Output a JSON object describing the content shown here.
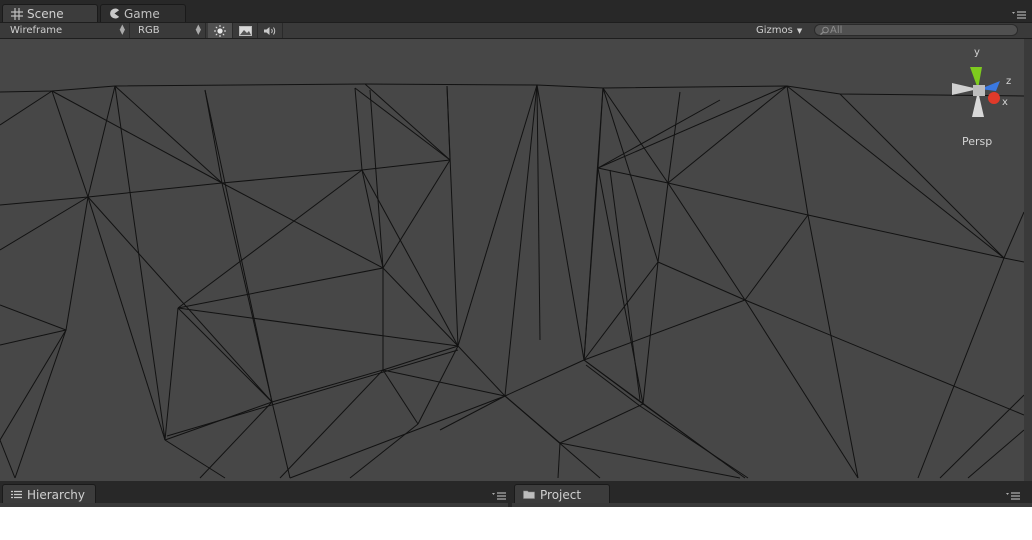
{
  "scene_view": {
    "tabs": [
      {
        "label": "Scene",
        "icon": "grid-icon",
        "active": true
      },
      {
        "label": "Game",
        "icon": "pacman-icon",
        "active": false
      }
    ],
    "toolbar": {
      "draw_mode": "Wireframe",
      "render_mode": "RGB",
      "toggles": [
        "sun-icon",
        "image-icon",
        "speaker-icon"
      ],
      "gizmos_label": "Gizmos",
      "search_placeholder": "All"
    },
    "orientation_gizmo": {
      "axes": {
        "y": "y",
        "z": "z",
        "x": "x"
      },
      "projection_label": "Persp",
      "colors": {
        "y": "#80d020",
        "z": "#3a78e0",
        "x": "#e03a2a"
      }
    }
  },
  "bottom_panels": {
    "hierarchy": {
      "label": "Hierarchy",
      "icon": "list-icon"
    },
    "project": {
      "label": "Project",
      "icon": "folder-icon"
    }
  },
  "colors": {
    "viewport_bg": "#474747",
    "toolbar_bg": "#3a3a3a",
    "tabbar_bg": "#282828",
    "wire": "#111111"
  }
}
